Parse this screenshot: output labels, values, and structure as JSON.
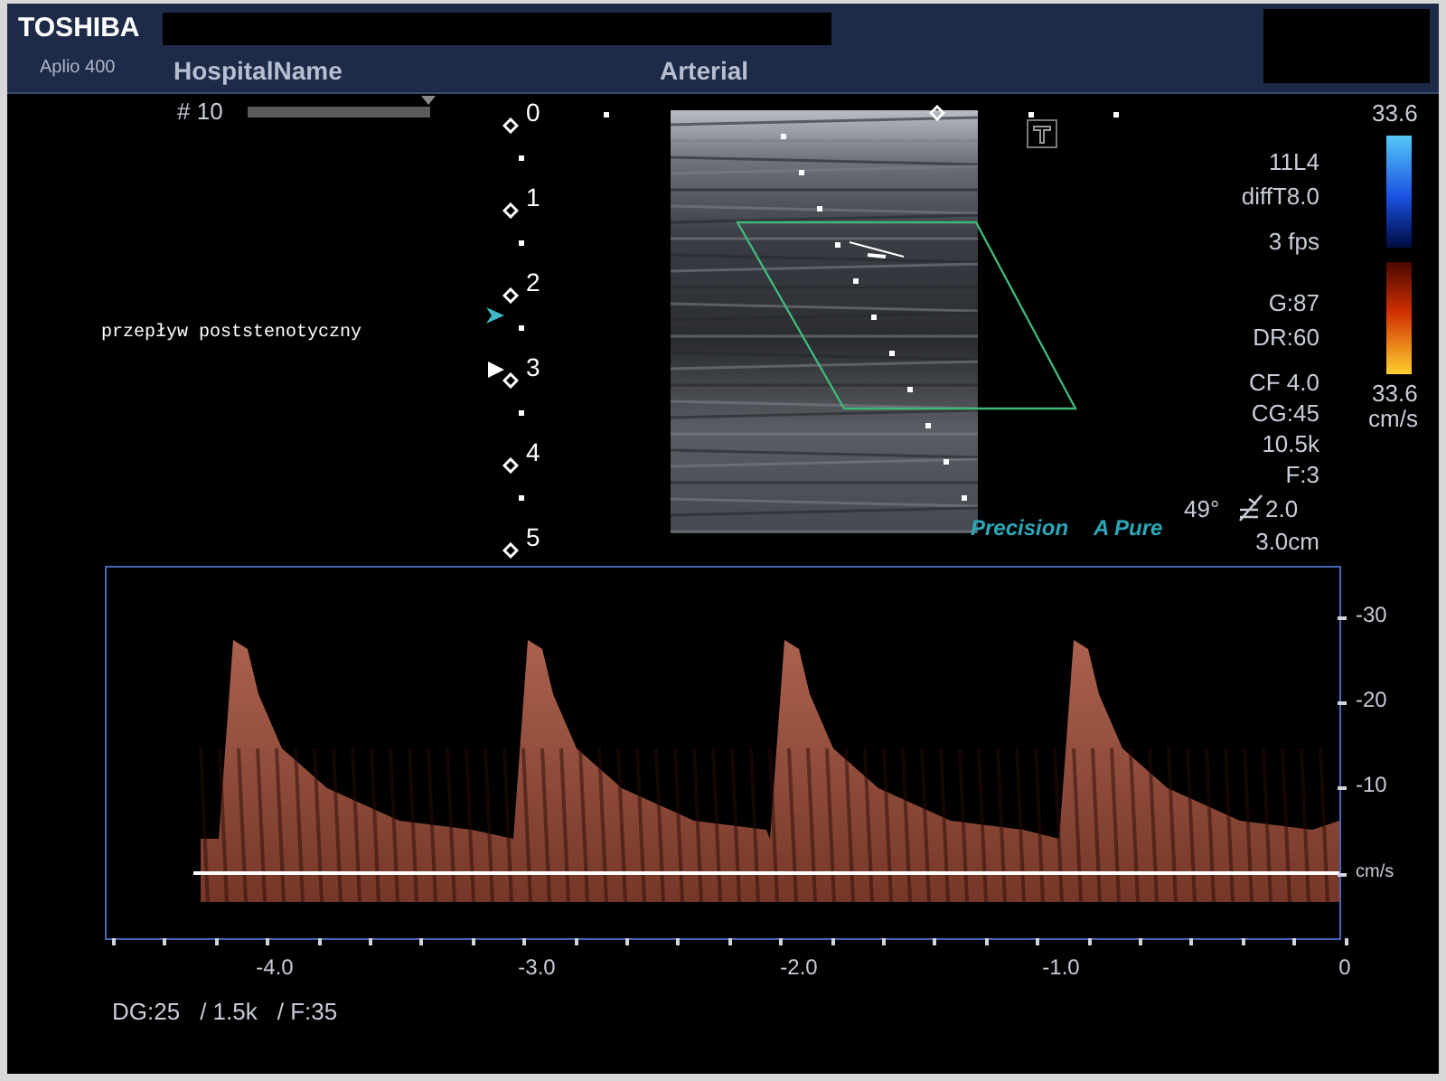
{
  "header": {
    "brand": "TOSHIBA",
    "model": "Aplio 400",
    "hospital": "HospitalName",
    "preset": "Arterial"
  },
  "frame_info": {
    "frame": "# 10"
  },
  "depth_marks": [
    "0",
    "1",
    "2",
    "3",
    "4",
    "5"
  ],
  "annotation": "przepływ poststenotyczny",
  "imaging_params": [
    "11L4",
    "diffT8.0",
    "3 fps",
    "G:87",
    "DR:60",
    "CF 4.0",
    "CG:45",
    "10.5k",
    "F:3"
  ],
  "angle": "49°",
  "steer": "2.0",
  "depth": "3.0cm",
  "color_scale": {
    "max": "33.6",
    "min": "33.6",
    "unit": "cm/s"
  },
  "logos": {
    "precision": "Precision",
    "apure": "A Pure"
  },
  "doppler": {
    "velocity_ticks": [
      "-30",
      "-20",
      "-10"
    ],
    "velocity_unit": "cm/s",
    "time_ticks": [
      "-4.0",
      "-3.0",
      "-2.0",
      "-1.0",
      "0"
    ]
  },
  "doppler_params": [
    "DG:25",
    "/ 1.5k",
    "/ F:35"
  ]
}
